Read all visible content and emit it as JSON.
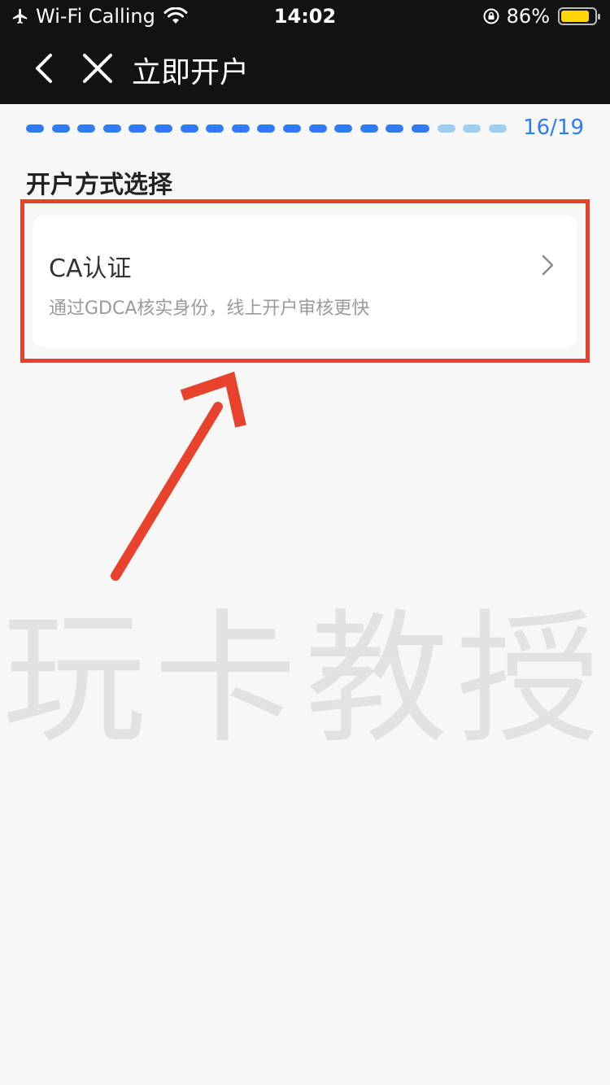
{
  "status_bar": {
    "carrier": "Wi-Fi Calling",
    "time": "14:02",
    "battery": "86%",
    "battery_level": 0.86
  },
  "nav": {
    "title": "立即开户"
  },
  "progress": {
    "current": 16,
    "total": 19,
    "label": "16/19"
  },
  "section": {
    "title": "开户方式选择"
  },
  "option": {
    "label": "CA认证",
    "description": "通过GDCA核实身份，线上开户审核更快"
  },
  "watermark": "玩卡教授",
  "colors": {
    "accent": "#2f7cf0",
    "pending": "#9fcdf0",
    "highlight": "#e8422c",
    "header_bg": "#121212"
  }
}
